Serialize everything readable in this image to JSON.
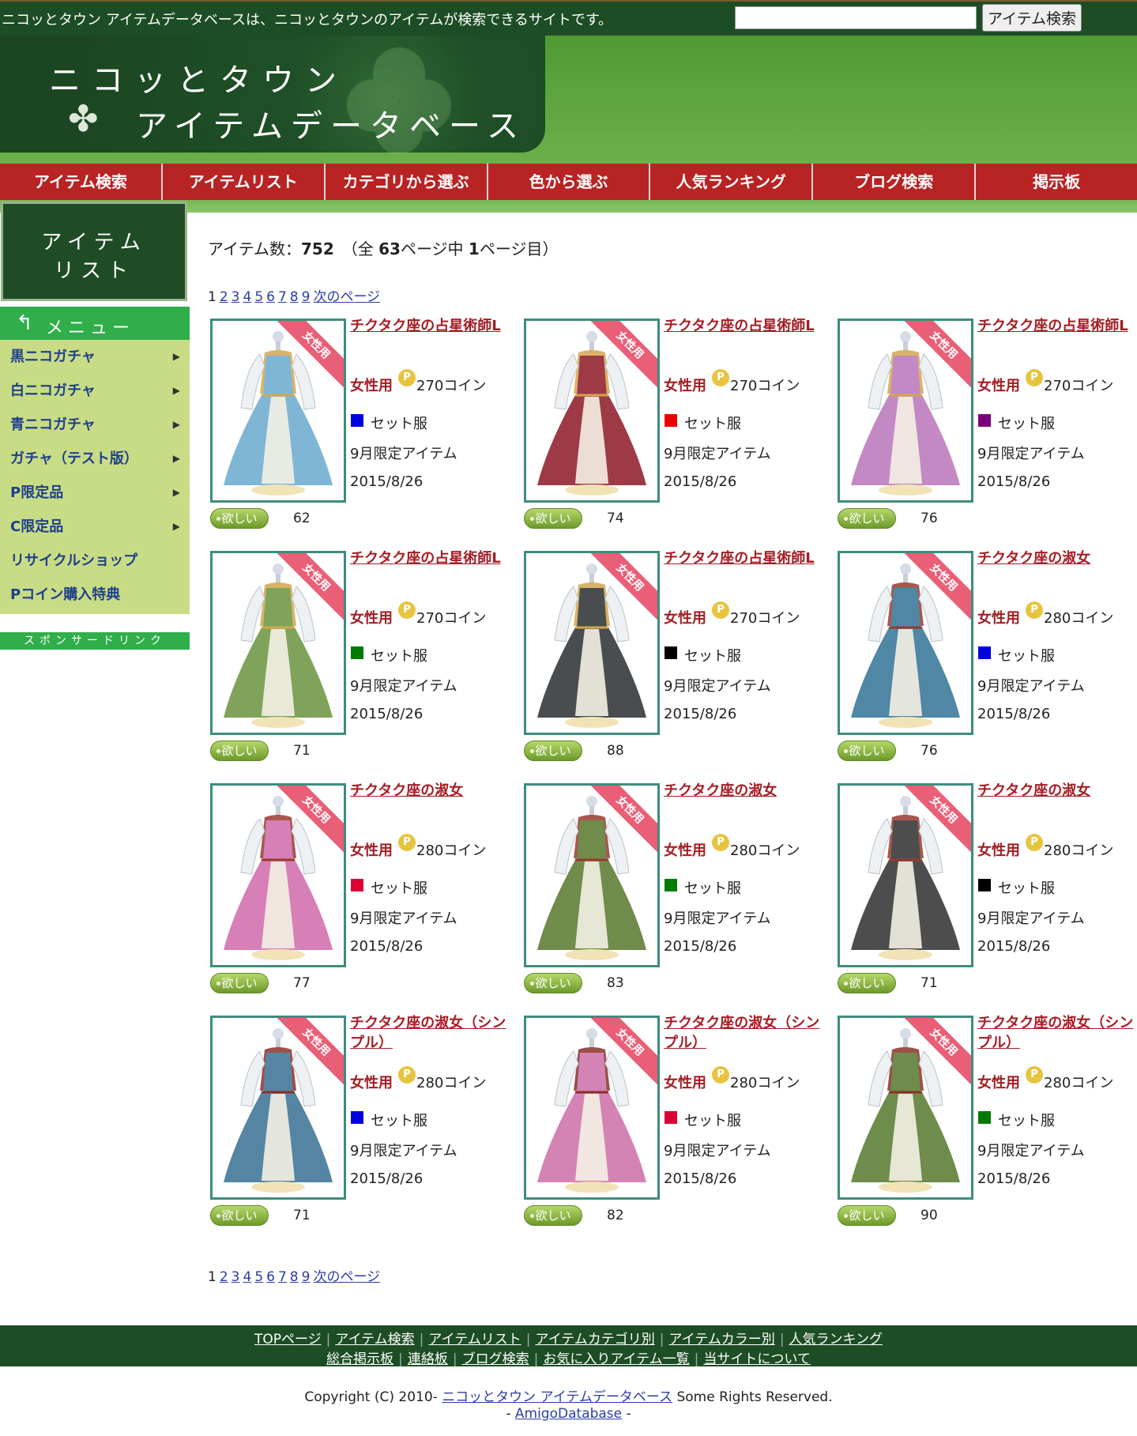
{
  "topbar": {
    "tagline": "ニコッとタウン アイテムデータベースは、ニコッとタウンのアイテムが検索できるサイトです。",
    "search_placeholder": "",
    "search_button": "アイテム検索"
  },
  "logo": {
    "line1": "ニコッとタウン",
    "line2": "アイテムデータベース"
  },
  "nav": [
    "アイテム検索",
    "アイテムリスト",
    "カテゴリから選ぶ",
    "色から選ぶ",
    "人気ランキング",
    "ブログ検索",
    "掲示板"
  ],
  "sidebar": {
    "title_line1": "アイテム",
    "title_line2": "リスト",
    "menu_title": "メニュー",
    "items": [
      {
        "label": "黒ニコガチャ",
        "caret": "▶"
      },
      {
        "label": "白ニコガチャ",
        "caret": "▶"
      },
      {
        "label": "青ニコガチャ",
        "caret": "▶"
      },
      {
        "label": "ガチャ（テスト版）",
        "caret": "▶"
      },
      {
        "label": "P限定品",
        "caret": "▶"
      },
      {
        "label": "C限定品",
        "caret": "▶"
      },
      {
        "label": "リサイクルショップ",
        "caret": ""
      },
      {
        "label": "Pコイン購入特典",
        "caret": ""
      }
    ],
    "sponsor": "スポンサードリンク"
  },
  "summary": {
    "prefix": "アイテム数：",
    "count": "752",
    "mid1": "（全",
    "total_pages": "63",
    "mid2": "ページ中",
    "current_page": "1",
    "suffix": "ページ目）"
  },
  "pager": {
    "current": "1",
    "pages": [
      "2",
      "3",
      "4",
      "5",
      "6",
      "7",
      "8",
      "9"
    ],
    "next": "次のページ"
  },
  "ribbon_text": "女性用",
  "want_label": "欲しい",
  "items": [
    {
      "name": "チクタク座の占星術師L",
      "gender": "女性用",
      "coin": "P",
      "price": "270コイン",
      "color": "#0000dd",
      "type": "セット服",
      "limited": "9月限定アイテム",
      "date": "2015/8/26",
      "wants": "62",
      "dress": "#7fb6d6",
      "trim": "#d4a64d"
    },
    {
      "name": "チクタク座の占星術師L",
      "gender": "女性用",
      "coin": "P",
      "price": "270コイン",
      "color": "#ee0000",
      "type": "セット服",
      "limited": "9月限定アイテム",
      "date": "2015/8/26",
      "wants": "74",
      "dress": "#9e3a46",
      "trim": "#d4a64d"
    },
    {
      "name": "チクタク座の占星術師L",
      "gender": "女性用",
      "coin": "P",
      "price": "270コイン",
      "color": "#7a007a",
      "type": "セット服",
      "limited": "9月限定アイテム",
      "date": "2015/8/26",
      "wants": "76",
      "dress": "#c389c4",
      "trim": "#d4a64d"
    },
    {
      "name": "チクタク座の占星術師L",
      "gender": "女性用",
      "coin": "P",
      "price": "270コイン",
      "color": "#007a00",
      "type": "セット服",
      "limited": "9月限定アイテム",
      "date": "2015/8/26",
      "wants": "71",
      "dress": "#7fa35a",
      "trim": "#d4a64d"
    },
    {
      "name": "チクタク座の占星術師L",
      "gender": "女性用",
      "coin": "P",
      "price": "270コイン",
      "color": "#000000",
      "type": "セット服",
      "limited": "9月限定アイテム",
      "date": "2015/8/26",
      "wants": "88",
      "dress": "#4a4d4f",
      "trim": "#d4a64d"
    },
    {
      "name": "チクタク座の淑女",
      "gender": "女性用",
      "coin": "P",
      "price": "280コイン",
      "color": "#0000dd",
      "type": "セット服",
      "limited": "9月限定アイテム",
      "date": "2015/8/26",
      "wants": "76",
      "dress": "#4f87a5",
      "trim": "#9a3a2f"
    },
    {
      "name": "チクタク座の淑女",
      "gender": "女性用",
      "coin": "P",
      "price": "280コイン",
      "color": "#dd0033",
      "type": "セット服",
      "limited": "9月限定アイテム",
      "date": "2015/8/26",
      "wants": "77",
      "dress": "#d77fb7",
      "trim": "#9a3a2f"
    },
    {
      "name": "チクタク座の淑女",
      "gender": "女性用",
      "coin": "P",
      "price": "280コイン",
      "color": "#007a00",
      "type": "セット服",
      "limited": "9月限定アイテム",
      "date": "2015/8/26",
      "wants": "83",
      "dress": "#6f8c4a",
      "trim": "#9a3a2f"
    },
    {
      "name": "チクタク座の淑女",
      "gender": "女性用",
      "coin": "P",
      "price": "280コイン",
      "color": "#000000",
      "type": "セット服",
      "limited": "9月限定アイテム",
      "date": "2015/8/26",
      "wants": "71",
      "dress": "#4d4d4d",
      "trim": "#9a3a2f"
    },
    {
      "name": "チクタク座の淑女（シンプル）",
      "gender": "女性用",
      "coin": "P",
      "price": "280コイン",
      "color": "#0000dd",
      "type": "セット服",
      "limited": "9月限定アイテム",
      "date": "2015/8/26",
      "wants": "71",
      "dress": "#5585a3",
      "trim": "#8a3128"
    },
    {
      "name": "チクタク座の淑女（シンプル）",
      "gender": "女性用",
      "coin": "P",
      "price": "280コイン",
      "color": "#dd0033",
      "type": "セット服",
      "limited": "9月限定アイテム",
      "date": "2015/8/26",
      "wants": "82",
      "dress": "#d483b5",
      "trim": "#8a3128"
    },
    {
      "name": "チクタク座の淑女（シンプル）",
      "gender": "女性用",
      "coin": "P",
      "price": "280コイン",
      "color": "#007a00",
      "type": "セット服",
      "limited": "9月限定アイテム",
      "date": "2015/8/26",
      "wants": "90",
      "dress": "#6e8c4c",
      "trim": "#8a3128"
    }
  ],
  "footer": {
    "row1": [
      "TOPページ",
      "アイテム検索",
      "アイテムリスト",
      "アイテムカテゴリ別",
      "アイテムカラー別",
      "人気ランキング"
    ],
    "row2": [
      "総合掲示板",
      "連絡板",
      "ブログ検索",
      "お気に入りアイテム一覧",
      "当サイトについて"
    ],
    "separator": "|",
    "copyright_prefix": "Copyright (C) 2010-",
    "copyright_link": "ニコッとタウン アイテムデータベース",
    "copyright_suffix": "Some Rights Reserved.",
    "credit_prefix": "-",
    "credit_link": "AmigoDatabase",
    "credit_suffix": "-"
  }
}
